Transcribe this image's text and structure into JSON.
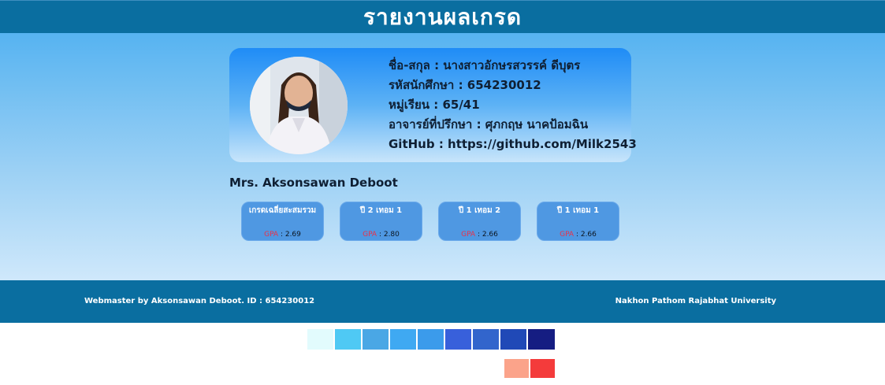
{
  "header": {
    "title": "รายงานผลเกรด"
  },
  "profile": {
    "name_line": "ชื่อ-สกุล : นางสาวอักษรสวรรค์ ดีบุตร",
    "student_id_line": "รหัสนักศึกษา : 654230012",
    "group_line": "หมู่เรียน : 65/41",
    "advisor_line": "อาจารย์ที่ปรึกษา : ศุภกฤษ นาคป้อมฉิน",
    "github_line": "GitHub : https://github.com/Milk2543",
    "name_en": "Mrs. Aksonsawan Deboot"
  },
  "grades": [
    {
      "title": "เกรดเฉลี่ยสะสมรวม",
      "gpa_label": "GPA",
      "gpa_value": " : 2.69"
    },
    {
      "title": "ปี 2 เทอม 1",
      "gpa_label": "GPA",
      "gpa_value": " : 2.80"
    },
    {
      "title": "ปี 1 เทอม 2",
      "gpa_label": "GPA",
      "gpa_value": " : 2.66"
    },
    {
      "title": "ปี 1 เทอม 1",
      "gpa_label": "GPA",
      "gpa_value": " : 2.66"
    }
  ],
  "footer": {
    "left": "Webmaster by Aksonsawan Deboot. ID : 654230012",
    "right": "Nakhon Pathom Rajabhat University"
  },
  "colors": {
    "header": "#0a6ea0",
    "card_accent": "#4f98e2",
    "gpa_label": "#e8324a",
    "palette": [
      "#e2fbfd",
      "#4fc9f4",
      "#4aa7e5",
      "#3fa9f2",
      "#3b9beb",
      "#3860db",
      "#3265cc",
      "#2049b7",
      "#151d82"
    ],
    "palette_warm": [
      "#fba38a",
      "#f43b3b"
    ]
  }
}
